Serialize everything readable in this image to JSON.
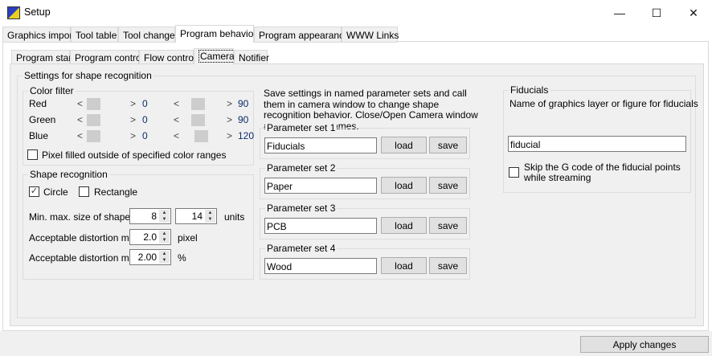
{
  "window": {
    "title": "Setup",
    "minimize": "—",
    "maximize": "☐",
    "close": "✕"
  },
  "tabs": [
    "Graphics import",
    "Tool table",
    "Tool change",
    "Program behavior",
    "Program appearance",
    "WWW Links"
  ],
  "subtabs": [
    "Program start",
    "Program control",
    "Flow control",
    "Camera",
    "Notifier"
  ],
  "main_group": "Settings for shape recognition",
  "color_filter": {
    "label": "Color filter",
    "rows": [
      {
        "label": "Red",
        "min": "0",
        "max": "90"
      },
      {
        "label": "Green",
        "min": "0",
        "max": "90"
      },
      {
        "label": "Blue",
        "min": "0",
        "max": "120"
      }
    ],
    "outside_label": "Pixel filled outside of specified color ranges"
  },
  "shape": {
    "label": "Shape recognition",
    "circle": "Circle",
    "rectangle": "Rectangle",
    "size_label": "Min. max. size of shape",
    "size_min": "8",
    "size_max": "14",
    "size_unit": "units",
    "dmin_label": "Acceptable distortion min.",
    "dmin": "2.0",
    "dmin_unit": "pixel",
    "dmax_label": "Acceptable distortion max.",
    "dmax": "2.00",
    "dmax_unit": "%"
  },
  "param_info": "Save settings in named parameter sets and call them in camera window to change shape recognition behavior. Close/Open Camera window after changing names.",
  "param_sets": [
    {
      "label": "Parameter set 1",
      "value": "Fiducials"
    },
    {
      "label": "Parameter set 2",
      "value": "Paper"
    },
    {
      "label": "Parameter set 3",
      "value": "PCB"
    },
    {
      "label": "Parameter set 4",
      "value": "Wood"
    }
  ],
  "load_label": "load",
  "save_label": "save",
  "fiducials": {
    "label": "Fiducials",
    "desc": "Name of graphics layer or figure for fiducials",
    "value": "fiducial",
    "skip_label": "Skip the G code of the fiducial points while streaming"
  },
  "apply_label": "Apply changes"
}
